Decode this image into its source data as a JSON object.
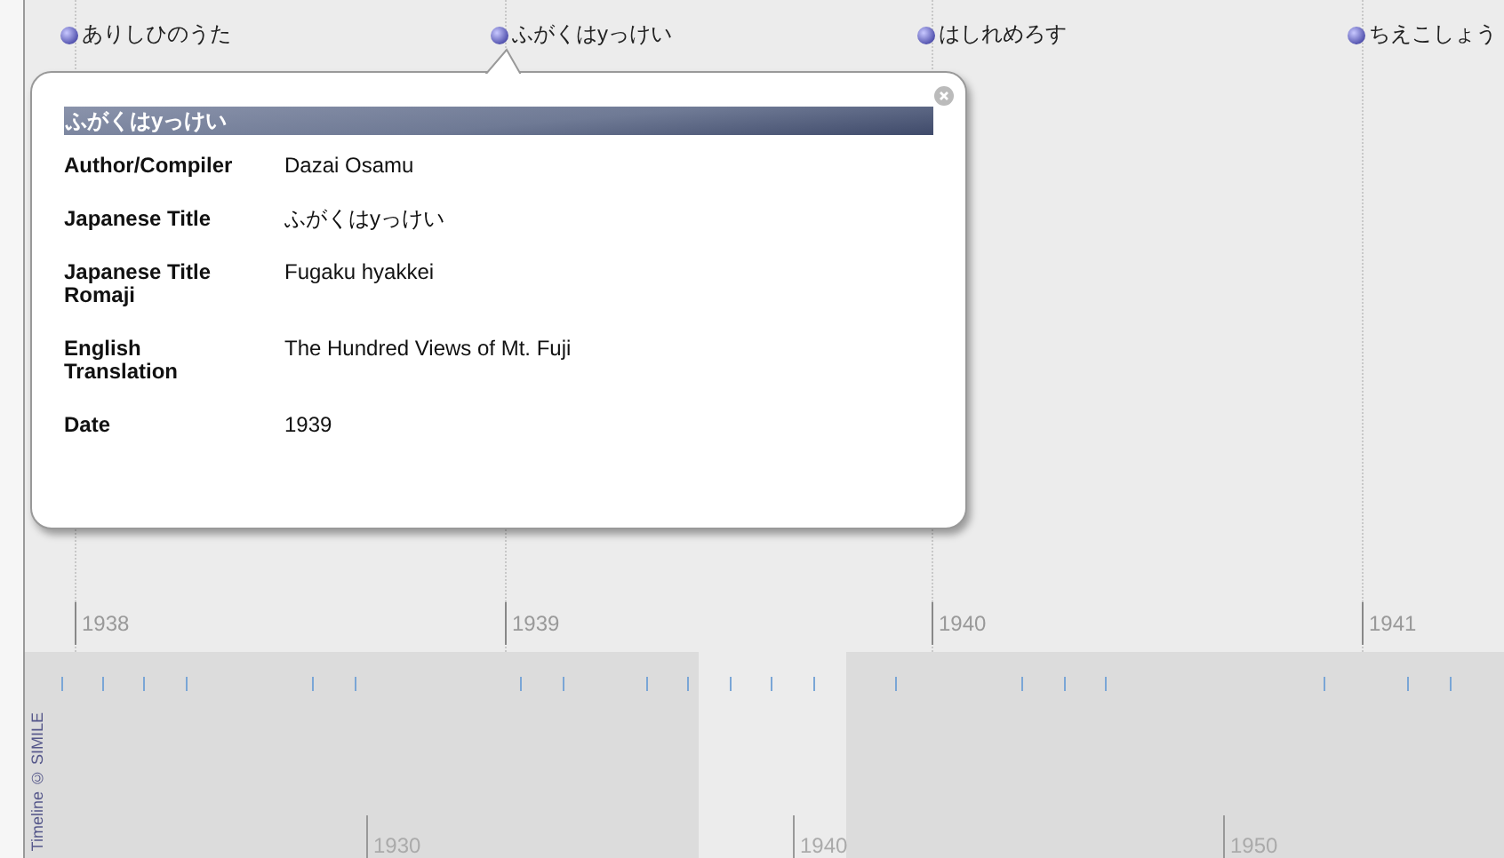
{
  "events": [
    {
      "label": "ありしひのうた"
    },
    {
      "label": "ふがくはyっけい"
    },
    {
      "label": "はしれめろす"
    },
    {
      "label": "ちえこしょう"
    }
  ],
  "years": [
    "1938",
    "1939",
    "1940",
    "1941"
  ],
  "popup": {
    "title": "ふがくはyっけい",
    "fields": [
      {
        "label": "Author/Compiler",
        "value": "Dazai Osamu"
      },
      {
        "label": "Japanese Title",
        "value": "ふがくはyっけい"
      },
      {
        "label": "Japanese Title Romaji",
        "value": "Fugaku hyakkei"
      },
      {
        "label": "English Translation",
        "value": "The Hundred Views of Mt. Fuji"
      },
      {
        "label": "Date",
        "value": "1939"
      }
    ]
  },
  "overview": {
    "decades": [
      "1930",
      "1940",
      "1950"
    ],
    "credit": "Timeline © SIMILE"
  }
}
